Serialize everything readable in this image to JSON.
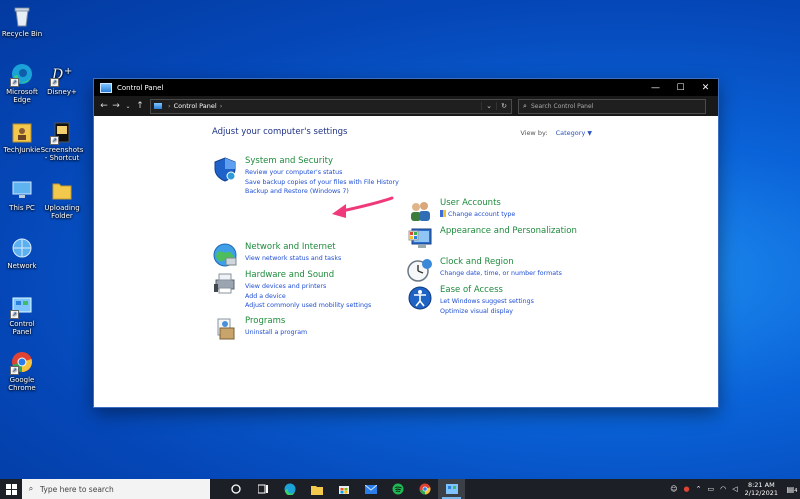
{
  "desktop": {
    "icons": [
      {
        "label": "Recycle Bin",
        "icon": "recycle-bin-icon"
      },
      {
        "label": "Microsoft Edge",
        "icon": "edge-icon"
      },
      {
        "label": "Disney+",
        "icon": "disney-plus-icon"
      },
      {
        "label": "TechJunkie",
        "icon": "folder-user-icon"
      },
      {
        "label": "Screenshots - Shortcut",
        "icon": "screenshots-icon"
      },
      {
        "label": "This PC",
        "icon": "this-pc-icon"
      },
      {
        "label": "Uploading Folder",
        "icon": "folder-icon"
      },
      {
        "label": "Network",
        "icon": "network-icon"
      },
      {
        "label": "Control Panel",
        "icon": "control-panel-icon"
      },
      {
        "label": "Google Chrome",
        "icon": "chrome-icon"
      }
    ]
  },
  "window": {
    "title": "Control Panel",
    "controls": {
      "minimize": "—",
      "maximize": "☐",
      "close": "✕"
    },
    "address": {
      "path": "Control Panel",
      "separator": "›"
    },
    "search": {
      "placeholder": "Search Control Panel"
    },
    "heading": "Adjust your computer's settings",
    "view_by": {
      "label": "View by:",
      "value": "Category"
    }
  },
  "categories": [
    {
      "title": "System and Security",
      "icon": "shield-icon",
      "links": [
        "Review your computer's status",
        "Save backup copies of your files with File History",
        "Backup and Restore (Windows 7)"
      ]
    },
    {
      "title": "Network and Internet",
      "icon": "globe-icon",
      "links": [
        "View network status and tasks"
      ]
    },
    {
      "title": "Hardware and Sound",
      "icon": "printer-icon",
      "links": [
        "View devices and printers",
        "Add a device",
        "Adjust commonly used mobility settings"
      ]
    },
    {
      "title": "Programs",
      "icon": "programs-icon",
      "links": [
        "Uninstall a program"
      ]
    },
    {
      "title": "User Accounts",
      "icon": "users-icon",
      "links": [
        "Change account type"
      ]
    },
    {
      "title": "Appearance and Personalization",
      "icon": "monitor-icon",
      "links": []
    },
    {
      "title": "Clock and Region",
      "icon": "clock-icon",
      "links": [
        "Change date, time, or number formats"
      ]
    },
    {
      "title": "Ease of Access",
      "icon": "ease-of-access-icon",
      "links": [
        "Let Windows suggest settings",
        "Optimize visual display"
      ]
    }
  ],
  "taskbar": {
    "search_placeholder": "Type here to search",
    "apps": [
      "task-view-icon",
      "widgets-icon",
      "edge-icon",
      "file-explorer-icon",
      "store-icon",
      "mail-icon",
      "spotify-icon",
      "chrome-icon",
      "control-panel-icon"
    ],
    "time": "8:21 AM",
    "date": "2/12/2021",
    "notifications": "4"
  },
  "colors": {
    "accent": "#1e8a3c",
    "link": "#1f4ed3",
    "heading": "#1e3287",
    "arrow": "#f0397a"
  }
}
